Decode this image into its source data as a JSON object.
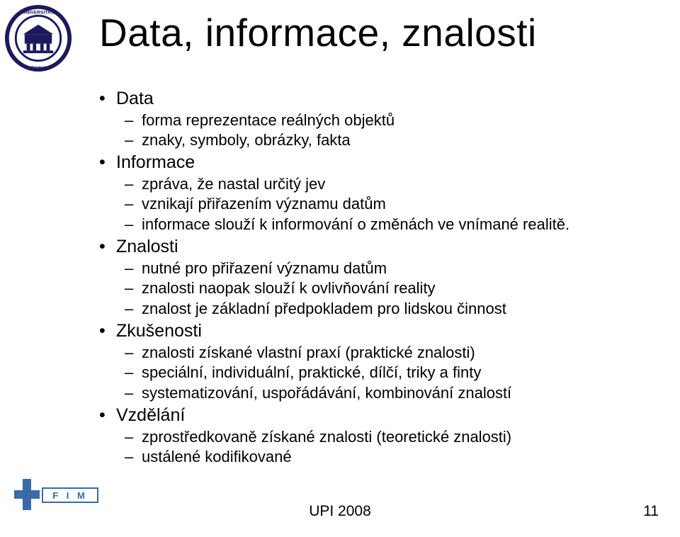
{
  "title": "Data, informace, znalosti",
  "bullets": {
    "b1": "Data",
    "b1_1": "forma reprezentace reálných objektů",
    "b1_2": "znaky, symboly, obrázky, fakta",
    "b2": "Informace",
    "b2_1": "zpráva, že nastal určitý jev",
    "b2_2": "vznikají přiřazením významu datům",
    "b2_3": "informace slouží k informování o změnách ve vnímané realitě.",
    "b3": "Znalosti",
    "b3_1": "nutné pro přiřazení významu datům",
    "b3_2": "znalosti naopak slouží k ovlivňování reality",
    "b3_3": "znalost je základní předpokladem pro lidskou činnost",
    "b4": "Zkušenosti",
    "b4_1": "znalosti získané vlastní praxí (praktické znalosti)",
    "b4_2": "speciální, individuální, praktické, dílčí, triky a finty",
    "b4_3": "systematizování, uspořádávání, kombinování znalostí",
    "b5": "Vzdělání",
    "b5_1": "zprostředkovaně získané znalosti (teoretické znalosti)",
    "b5_2": "ustálené kodifikované"
  },
  "footer": {
    "course": "UPI 2008",
    "page": "11"
  },
  "logos": {
    "top_left": "university-seal",
    "bottom_left": "fim-logo",
    "fim_text": "F I M"
  }
}
